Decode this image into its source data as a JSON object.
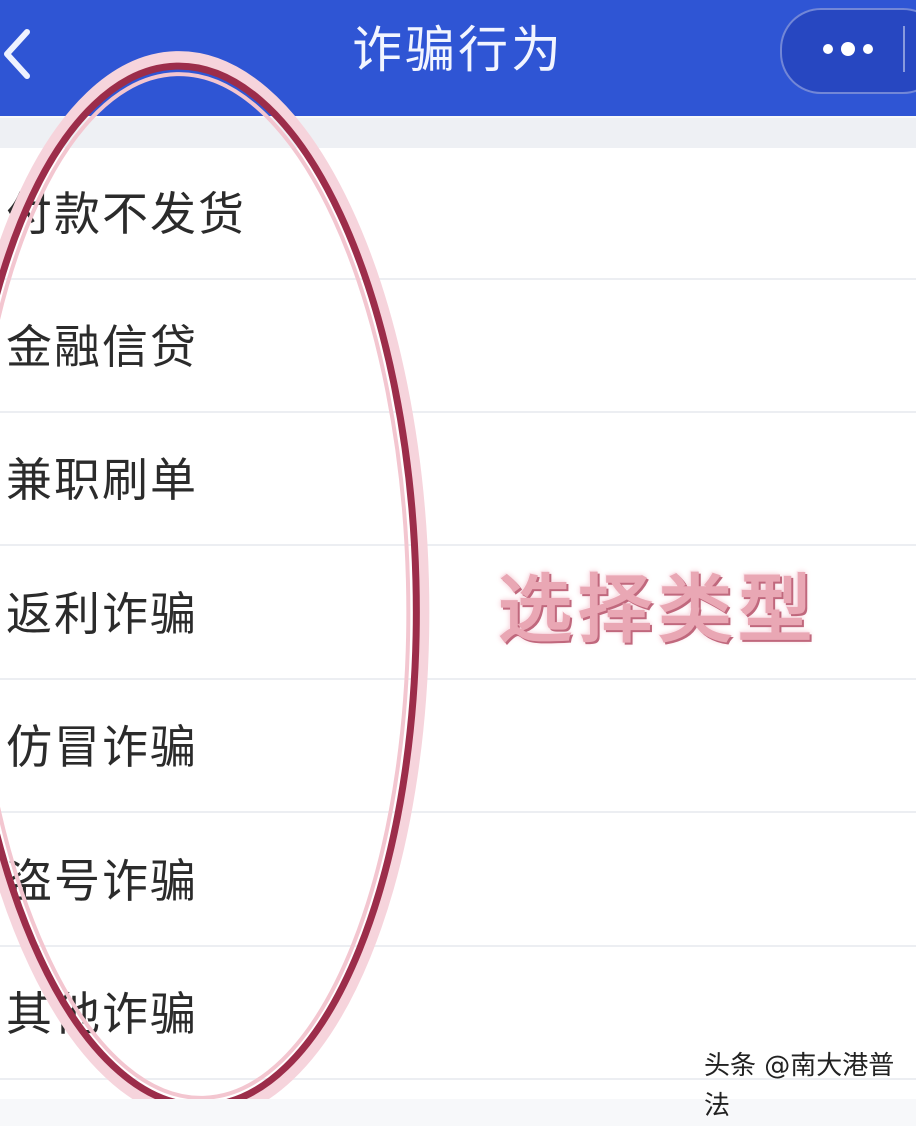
{
  "header": {
    "title": "诈骗行为",
    "back_icon": "chevron-left-icon",
    "more_icon": "more-dots-icon"
  },
  "list": {
    "items": [
      {
        "label": "付款不发货"
      },
      {
        "label": "金融信贷"
      },
      {
        "label": "兼职刷单"
      },
      {
        "label": "返利诈骗"
      },
      {
        "label": "仿冒诈骗"
      },
      {
        "label": "盗号诈骗"
      },
      {
        "label": "其他诈骗"
      }
    ]
  },
  "annotation": {
    "text": "选择类型"
  },
  "watermark": {
    "text": "头条 @南大港普法"
  },
  "colors": {
    "header_bg": "#2f55d4",
    "annotation_ring": "#9c2d4a",
    "annotation_text": "#e9a7b4"
  }
}
